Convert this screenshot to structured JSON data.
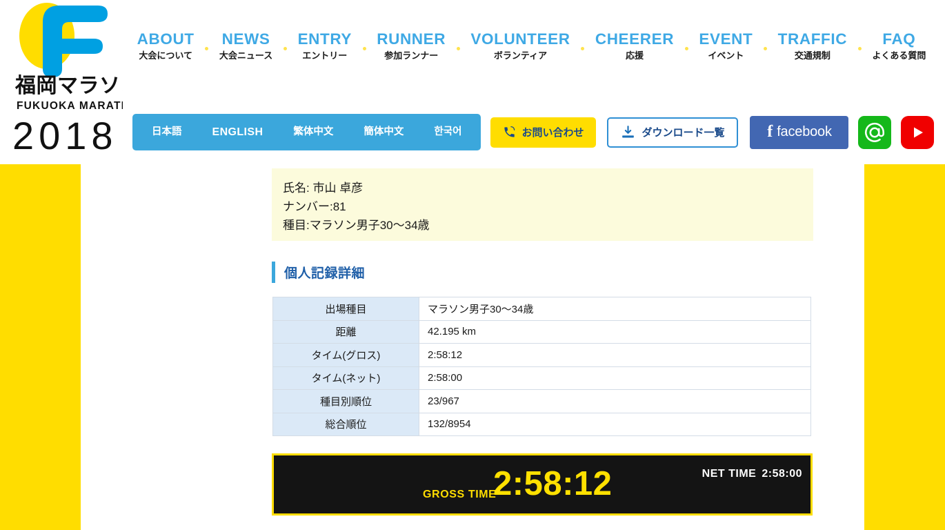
{
  "site": {
    "logo_title_ja": "福岡マラソン",
    "logo_title_en": "FUKUOKA MARATHON",
    "logo_year": "2018",
    "brand_blue": "#3ba7dc",
    "brand_yellow": "#ffdd00"
  },
  "nav": {
    "items": [
      {
        "en": "ABOUT",
        "ja": "大会について"
      },
      {
        "en": "NEWS",
        "ja": "大会ニュース"
      },
      {
        "en": "ENTRY",
        "ja": "エントリー"
      },
      {
        "en": "RUNNER",
        "ja": "参加ランナー"
      },
      {
        "en": "VOLUNTEER",
        "ja": "ボランティア"
      },
      {
        "en": "CHEERER",
        "ja": "応援"
      },
      {
        "en": "EVENT",
        "ja": "イベント"
      },
      {
        "en": "TRAFFIC",
        "ja": "交通規制"
      },
      {
        "en": "FAQ",
        "ja": "よくある質問"
      }
    ]
  },
  "languages": [
    {
      "label": "日本語"
    },
    {
      "label": "ENGLISH"
    },
    {
      "label": "繁体中文"
    },
    {
      "label": "簡体中文"
    },
    {
      "label": "한국어"
    }
  ],
  "util_buttons": {
    "contact_label": "お問い合わせ",
    "download_label": "ダウンロード一覧",
    "facebook_label": "facebook",
    "atmark_icon": "at-mark-icon",
    "youtube_icon": "youtube-play-icon"
  },
  "runner": {
    "name_line": "氏名: 市山 卓彦",
    "number_line": "ナンバー:81",
    "category_line": "種目:マラソン男子30〜34歳"
  },
  "section": {
    "title": "個人記録詳細"
  },
  "record_table": {
    "rows": [
      {
        "label": "出場種目",
        "value": "マラソン男子30〜34歳"
      },
      {
        "label": "距離",
        "value": "42.195 km"
      },
      {
        "label": "タイム(グロス)",
        "value": "2:58:12"
      },
      {
        "label": "タイム(ネット)",
        "value": "2:58:00"
      },
      {
        "label": "種目別順位",
        "value": "23/967"
      },
      {
        "label": "総合順位",
        "value": "132/8954"
      }
    ]
  },
  "time_banner": {
    "gross_label": "GROSS TIME",
    "gross_value": "2:58:12",
    "net_label": "NET TIME",
    "net_value": "2:58:00"
  }
}
